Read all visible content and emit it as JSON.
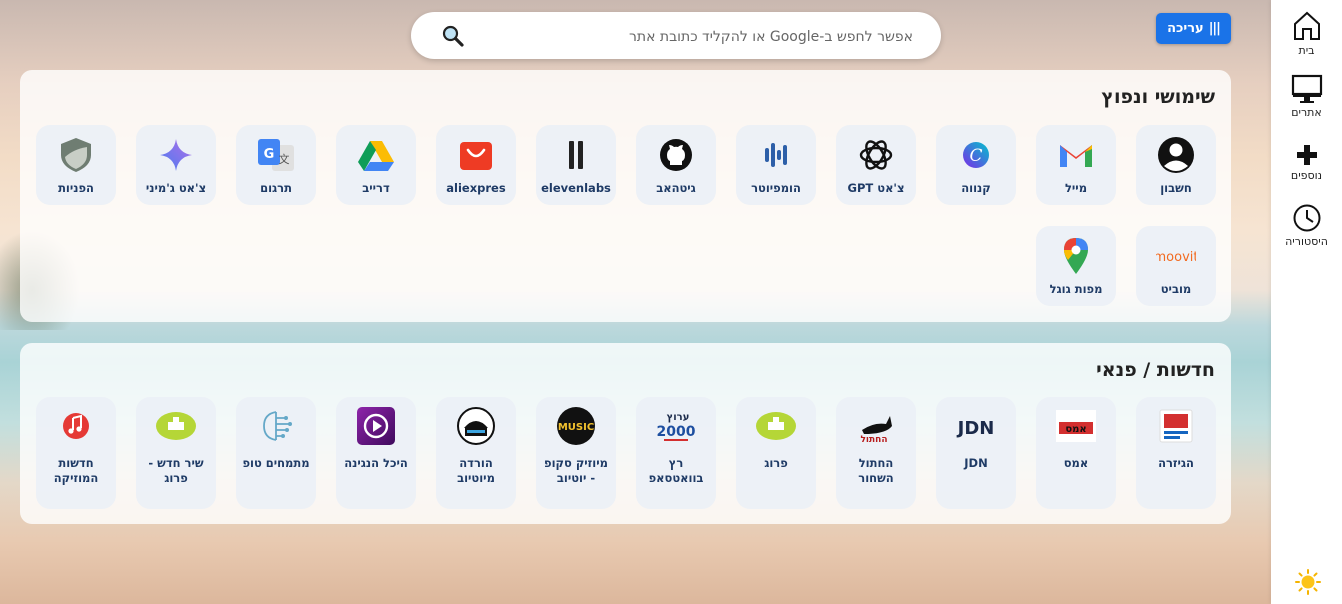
{
  "search": {
    "placeholder": "אפשר לחפש ב-Google או להקליד כתובת אתר",
    "value": ""
  },
  "edit_button": {
    "label": "עריכה",
    "bars": "|||"
  },
  "sidebar": {
    "items": [
      {
        "label": "בית",
        "icon": "home-icon"
      },
      {
        "label": "אתרים",
        "icon": "monitor-icon"
      },
      {
        "label": "נוספים",
        "icon": "plus-icon"
      },
      {
        "label": "היסטוריה",
        "icon": "clock-icon"
      }
    ],
    "theme_icon": "sun-icon"
  },
  "sections": [
    {
      "title": "שימושי ונפוץ",
      "tiles": [
        {
          "label": "חשבון",
          "icon": "account-icon"
        },
        {
          "label": "מייל",
          "icon": "gmail-icon"
        },
        {
          "label": "קנווה",
          "icon": "canva-icon"
        },
        {
          "label": "צ'אט GPT",
          "icon": "chatgpt-icon"
        },
        {
          "label": "הומפיוטר",
          "icon": "waveform-icon"
        },
        {
          "label": "גיטהאב",
          "icon": "github-icon"
        },
        {
          "label": "elevenlabs",
          "icon": "elevenlabs-icon"
        },
        {
          "label": "aliexpres",
          "icon": "aliexpress-icon"
        },
        {
          "label": "דרייב",
          "icon": "drive-icon"
        },
        {
          "label": "תרגום",
          "icon": "translate-icon"
        },
        {
          "label": "צ'אט ג'מיני",
          "icon": "gemini-icon"
        },
        {
          "label": "הפניות",
          "icon": "shield-icon"
        },
        {
          "label": "מוביט",
          "icon": "moovit-icon",
          "logo_text": "moovit"
        },
        {
          "label": "מפות גוגל",
          "icon": "maps-pin-icon"
        }
      ]
    },
    {
      "title": "חדשות / פנאי",
      "tiles": [
        {
          "label": "הגיזרה",
          "icon": "news-icon"
        },
        {
          "label": "אמס",
          "icon": "ams-icon",
          "logo_text": "אמס"
        },
        {
          "label": "JDN",
          "icon": "jdn-icon",
          "logo_text": "JDN"
        },
        {
          "label": "החתול השחור",
          "icon": "black-cat-icon",
          "logo_text": "החתול"
        },
        {
          "label": "פרוג",
          "icon": "prog-icon"
        },
        {
          "label": "רץ בוואטסאפ",
          "icon": "channel-2000-icon",
          "logo_text": "2000",
          "logo_sub": "ערוץ"
        },
        {
          "label": "מיוזיק סקופ - יוטיוב",
          "icon": "music-scoop-icon",
          "logo_text": "MUSIC"
        },
        {
          "label": "הורדה מיוטיוב",
          "icon": "download-youtube-icon"
        },
        {
          "label": "היכל הנגינה",
          "icon": "play-icon"
        },
        {
          "label": "מתמחים טופ",
          "icon": "circuit-icon"
        },
        {
          "label": "שיר חדש - פרוג",
          "icon": "prog-icon"
        },
        {
          "label": "חדשות המוזיקה",
          "icon": "music-note-icon"
        }
      ]
    }
  ],
  "colors": {
    "accent": "#1a73e8",
    "tile_label": "#1f3b66"
  }
}
